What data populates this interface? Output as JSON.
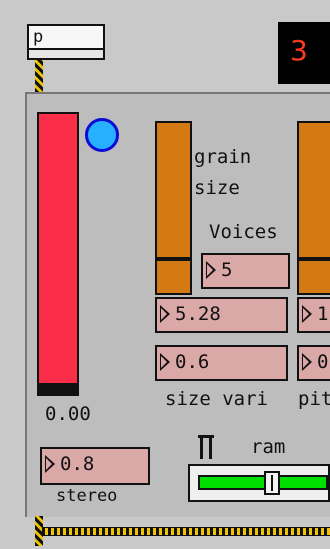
{
  "top": {
    "message_box_text": "p",
    "led_number": "3"
  },
  "meter": {
    "value": "0.00",
    "level": 0.96
  },
  "grain_size": {
    "label_line1": "grain",
    "label_line2": "size",
    "slider_level": 0.2
  },
  "voices": {
    "label": "Voices",
    "value": "5"
  },
  "size": {
    "value": "5.28",
    "vari_value": "0.6",
    "vari_label": "size vari"
  },
  "pitch": {
    "value_partial": "1",
    "vari_value_partial": "0",
    "label_partial": "pit"
  },
  "stereo": {
    "value": "0.8",
    "label": "stereo"
  },
  "ramp": {
    "label": "ram",
    "slider_value": 0.58
  },
  "colors": {
    "meter": "#fa2e48",
    "orange": "#d37a14",
    "numbox": "#dba8a8",
    "led_text": "#ff3b1f",
    "button_fill": "#27b0ff",
    "slider_green": "#00e000"
  },
  "icons": {
    "toggle": "pi-toggle-icon",
    "numbox_arrow": "triangle-arrow-icon"
  }
}
